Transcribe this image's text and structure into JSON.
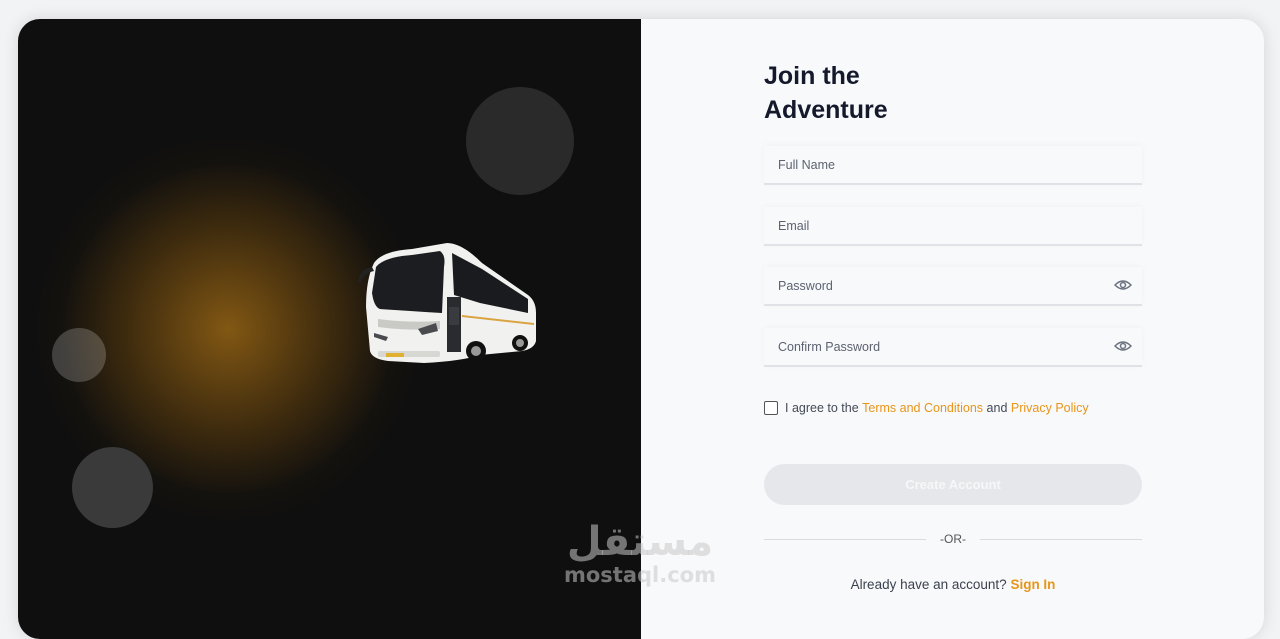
{
  "colors": {
    "accent": "#e8951a",
    "dark_panel": "#0f0f0f",
    "title": "#141a2c"
  },
  "watermark": {
    "arabic": "مستقل",
    "latin": "mostaql.com"
  },
  "form": {
    "title_line1": "Join the",
    "title_line2": "Adventure",
    "full_name_placeholder": "Full Name",
    "email_placeholder": "Email",
    "password_placeholder": "Password",
    "confirm_password_placeholder": "Confirm Password",
    "password_toggle_icon": "eye-icon",
    "agree": {
      "prefix": "I agree to the",
      "terms": "Terms and Conditions",
      "and": "and",
      "privacy": "Privacy Policy"
    },
    "create_account": "Create Account",
    "or_divider": "-OR-",
    "have_account": "Already have an account?",
    "sign_in": "Sign In"
  }
}
